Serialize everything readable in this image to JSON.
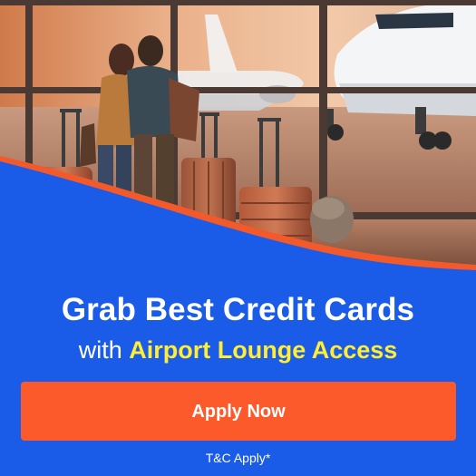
{
  "headline": {
    "line1": "Grab Best Credit Cards",
    "line2_prefix": "with ",
    "line2_highlight": "Airport Lounge Access"
  },
  "cta": {
    "label": "Apply Now"
  },
  "footer": {
    "terms": "T&C Apply*"
  },
  "colors": {
    "background_blue": "#1a5be8",
    "button_orange": "#fd5a2c",
    "highlight_yellow": "#ffee33",
    "text_white": "#ffffff"
  }
}
